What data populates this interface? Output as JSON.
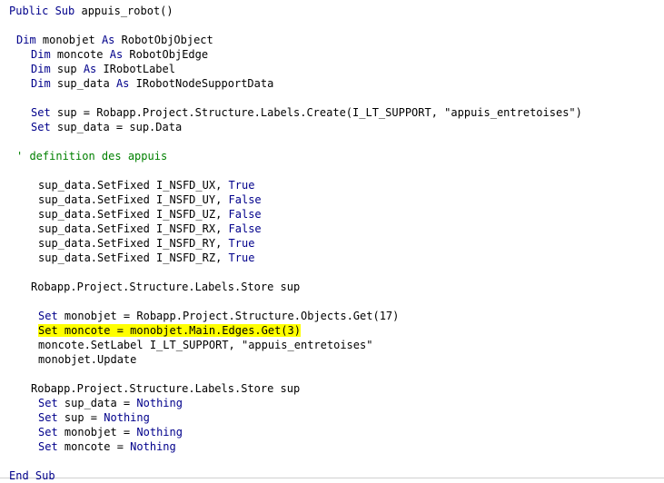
{
  "editor": {
    "lines": [
      {
        "indent": 1,
        "tokens": [
          {
            "t": "Public Sub",
            "k": "kw"
          },
          {
            "t": " appuis_robot()",
            "k": "tx"
          }
        ]
      },
      {
        "indent": 2,
        "tokens": [
          {
            "t": "Dim",
            "k": "kw"
          },
          {
            "t": " monobjet ",
            "k": "tx"
          },
          {
            "t": "As",
            "k": "kw"
          },
          {
            "t": " RobotObjObject",
            "k": "tx"
          }
        ]
      },
      {
        "indent": 4,
        "tokens": [
          {
            "t": "Dim",
            "k": "kw"
          },
          {
            "t": " moncote ",
            "k": "tx"
          },
          {
            "t": "As",
            "k": "kw"
          },
          {
            "t": " RobotObjEdge",
            "k": "tx"
          }
        ]
      },
      {
        "indent": 4,
        "tokens": [
          {
            "t": "Dim",
            "k": "kw"
          },
          {
            "t": " sup ",
            "k": "tx"
          },
          {
            "t": "As",
            "k": "kw"
          },
          {
            "t": " IRobotLabel",
            "k": "tx"
          }
        ]
      },
      {
        "indent": 4,
        "tokens": [
          {
            "t": "Dim",
            "k": "kw"
          },
          {
            "t": " sup_data ",
            "k": "tx"
          },
          {
            "t": "As",
            "k": "kw"
          },
          {
            "t": " IRobotNodeSupportData",
            "k": "tx"
          }
        ]
      },
      {
        "indent": 4,
        "tokens": [
          {
            "t": "Set",
            "k": "kw"
          },
          {
            "t": " sup = Robapp.Project.Structure.Labels.Create(I_LT_SUPPORT, \"appuis_entretoises\")",
            "k": "tx"
          }
        ]
      },
      {
        "indent": 4,
        "tokens": [
          {
            "t": "Set",
            "k": "kw"
          },
          {
            "t": " sup_data = sup.Data",
            "k": "tx"
          }
        ]
      },
      {
        "indent": 2,
        "tokens": [
          {
            "t": "' definition des appuis",
            "k": "cm"
          }
        ]
      },
      {
        "indent": 5,
        "tokens": [
          {
            "t": "sup_data.SetFixed I_NSFD_UX, ",
            "k": "tx"
          },
          {
            "t": "True",
            "k": "kw"
          }
        ]
      },
      {
        "indent": 5,
        "tokens": [
          {
            "t": "sup_data.SetFixed I_NSFD_UY, ",
            "k": "tx"
          },
          {
            "t": "False",
            "k": "kw"
          }
        ]
      },
      {
        "indent": 5,
        "tokens": [
          {
            "t": "sup_data.SetFixed I_NSFD_UZ, ",
            "k": "tx"
          },
          {
            "t": "False",
            "k": "kw"
          }
        ]
      },
      {
        "indent": 5,
        "tokens": [
          {
            "t": "sup_data.SetFixed I_NSFD_RX, ",
            "k": "tx"
          },
          {
            "t": "False",
            "k": "kw"
          }
        ]
      },
      {
        "indent": 5,
        "tokens": [
          {
            "t": "sup_data.SetFixed I_NSFD_RY, ",
            "k": "tx"
          },
          {
            "t": "True",
            "k": "kw"
          }
        ]
      },
      {
        "indent": 5,
        "tokens": [
          {
            "t": "sup_data.SetFixed I_NSFD_RZ, ",
            "k": "tx"
          },
          {
            "t": "True",
            "k": "kw"
          }
        ]
      },
      {
        "indent": 4,
        "tokens": [
          {
            "t": "Robapp.Project.Structure.Labels.Store sup",
            "k": "tx"
          }
        ]
      },
      {
        "indent": 5,
        "tokens": [
          {
            "t": "Set",
            "k": "kw"
          },
          {
            "t": " monobjet = Robapp.Project.Structure.Objects.Get(17)",
            "k": "tx"
          }
        ]
      },
      {
        "indent": 5,
        "highlight": true,
        "tokens": [
          {
            "t": "Set moncote = monobjet.Main.Edges.Get(3)",
            "k": "tx"
          }
        ]
      },
      {
        "indent": 5,
        "tokens": [
          {
            "t": "moncote.SetLabel I_LT_SUPPORT, \"appuis_entretoises\"",
            "k": "tx"
          }
        ]
      },
      {
        "indent": 5,
        "tokens": [
          {
            "t": "monobjet.Update",
            "k": "tx"
          }
        ]
      },
      {
        "indent": 4,
        "tokens": [
          {
            "t": "Robapp.Project.Structure.Labels.Store sup",
            "k": "tx"
          }
        ]
      },
      {
        "indent": 5,
        "tokens": [
          {
            "t": "Set",
            "k": "kw"
          },
          {
            "t": " sup_data = ",
            "k": "tx"
          },
          {
            "t": "Nothing",
            "k": "kw"
          }
        ]
      },
      {
        "indent": 5,
        "tokens": [
          {
            "t": "Set",
            "k": "kw"
          },
          {
            "t": " sup = ",
            "k": "tx"
          },
          {
            "t": "Nothing",
            "k": "kw"
          }
        ]
      },
      {
        "indent": 5,
        "tokens": [
          {
            "t": "Set",
            "k": "kw"
          },
          {
            "t": " monobjet = ",
            "k": "tx"
          },
          {
            "t": "Nothing",
            "k": "kw"
          }
        ]
      },
      {
        "indent": 5,
        "tokens": [
          {
            "t": "Set",
            "k": "kw"
          },
          {
            "t": " moncote = ",
            "k": "tx"
          },
          {
            "t": "Nothing",
            "k": "kw"
          }
        ]
      },
      {
        "indent": 1,
        "tokens": [
          {
            "t": "End Sub",
            "k": "kw"
          }
        ]
      }
    ]
  },
  "colors": {
    "keyword": "#00008b",
    "comment": "#008000",
    "text": "#000000",
    "highlight": "#ffff00",
    "background": "#ffffff"
  }
}
